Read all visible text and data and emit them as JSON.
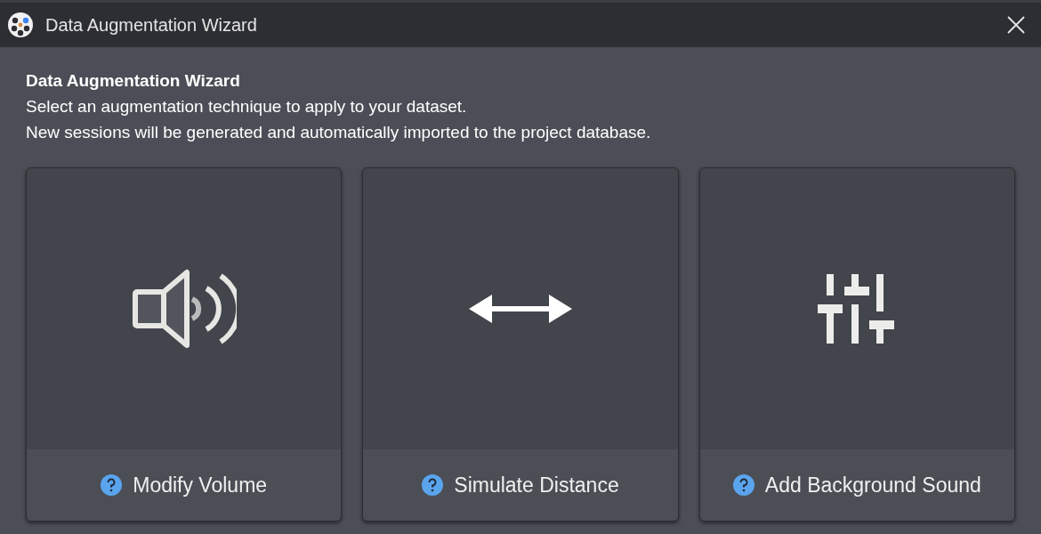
{
  "window": {
    "title": "Data Augmentation Wizard"
  },
  "heading": "Data Augmentation Wizard",
  "description": [
    "Select an augmentation technique to apply to your dataset.",
    "New sessions will be generated and automatically imported to the project database."
  ],
  "options": [
    {
      "kind": "speaker",
      "label": "Modify Volume"
    },
    {
      "kind": "arrows",
      "label": "Simulate Distance"
    },
    {
      "kind": "sliders",
      "label": "Add Background Sound"
    }
  ]
}
